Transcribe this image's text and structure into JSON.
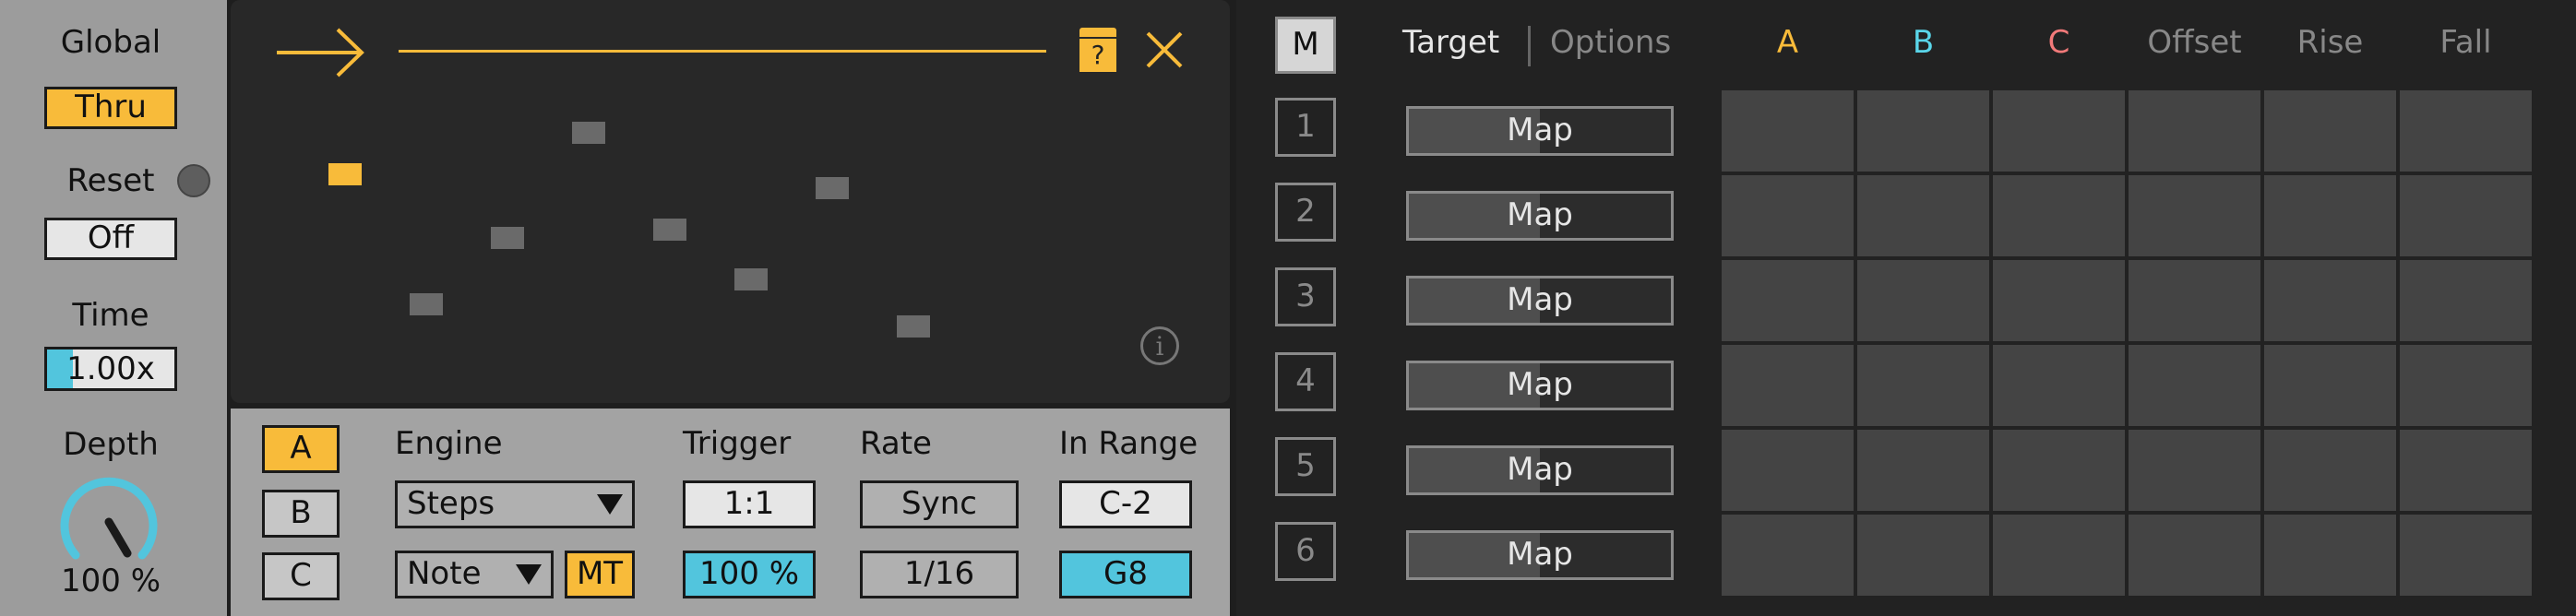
{
  "left": {
    "global_label": "Global",
    "global_value": "Thru",
    "reset_label": "Reset",
    "reset_value": "Off",
    "time_label": "Time",
    "time_value": "1.00x",
    "time_fill": 0.2,
    "depth_label": "Depth",
    "depth_value": "100 %",
    "depth_level": 1.0
  },
  "sequencer": {
    "steps_y_levels": [
      0.35,
      0.82,
      0.58,
      0.2,
      0.55,
      0.73,
      0.4,
      0.9
    ],
    "active_step": 0,
    "info_glyph": "i",
    "help_glyph": "?"
  },
  "controls": {
    "channel_buttons": [
      "A",
      "B",
      "C"
    ],
    "selected_channel": "A",
    "engine_label": "Engine",
    "engine_value": "Steps",
    "note_value": "Note",
    "mt_label": "MT",
    "trigger_label": "Trigger",
    "trigger_value": "1:1",
    "trigger_pct": "100 %",
    "rate_label": "Rate",
    "rate_value": "Sync",
    "rate_division": "1/16",
    "range_label": "In Range",
    "range_low": "C-2",
    "range_high": "G8"
  },
  "right": {
    "m_label": "M",
    "tab_target": "Target",
    "tab_options": "Options",
    "columns": [
      {
        "label": "A",
        "color": "#f8bb3a"
      },
      {
        "label": "B",
        "color": "#5ad6ea"
      },
      {
        "label": "C",
        "color": "#f27a7a"
      },
      {
        "label": "Offset",
        "color": "#888888"
      },
      {
        "label": "Rise",
        "color": "#888888"
      },
      {
        "label": "Fall",
        "color": "#888888"
      }
    ],
    "rows": [
      {
        "num": "1",
        "map": "Map"
      },
      {
        "num": "2",
        "map": "Map"
      },
      {
        "num": "3",
        "map": "Map"
      },
      {
        "num": "4",
        "map": "Map"
      },
      {
        "num": "5",
        "map": "Map"
      },
      {
        "num": "6",
        "map": "Map"
      }
    ]
  },
  "colors": {
    "accent_orange": "#f8bb3a",
    "accent_cyan": "#52c5dd",
    "panel_dark": "#282828",
    "panel_gray": "#9c9c9c"
  }
}
